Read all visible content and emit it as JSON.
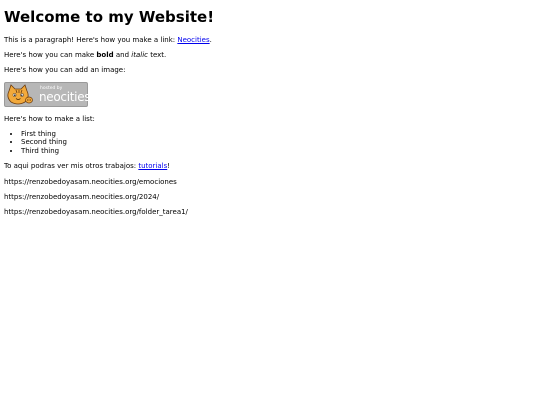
{
  "heading": "Welcome to my Website!",
  "intro": {
    "before": "This is a paragraph! Here's how you make a link: ",
    "link_text": "Neocities",
    "after": "."
  },
  "format_line": {
    "before": "Here's how you can make ",
    "bold": "bold",
    "middle": " and ",
    "italic": "italic",
    "after": " text."
  },
  "image_line": "Here's how you can add an image:",
  "badge": {
    "small_text": "hosted by",
    "big_text": "neocities",
    "icon": "neocities-cat-logo",
    "background": "#b7b7b7"
  },
  "list_line": "Here's how to make a list:",
  "list_items": [
    "First thing",
    "Second thing",
    "Third thing"
  ],
  "works_line": {
    "before": "To aqui podras ver mis otros trabajos: ",
    "link_text": "tutorials",
    "after": "!"
  },
  "urls": [
    "https://renzobedoyasam.neocities.org/emociones",
    "https://renzobedoyasam.neocities.org/2024/",
    "https://renzobedoyasam.neocities.org/folder_tarea1/"
  ],
  "colors": {
    "link": "#0000ee",
    "text": "#000000"
  }
}
